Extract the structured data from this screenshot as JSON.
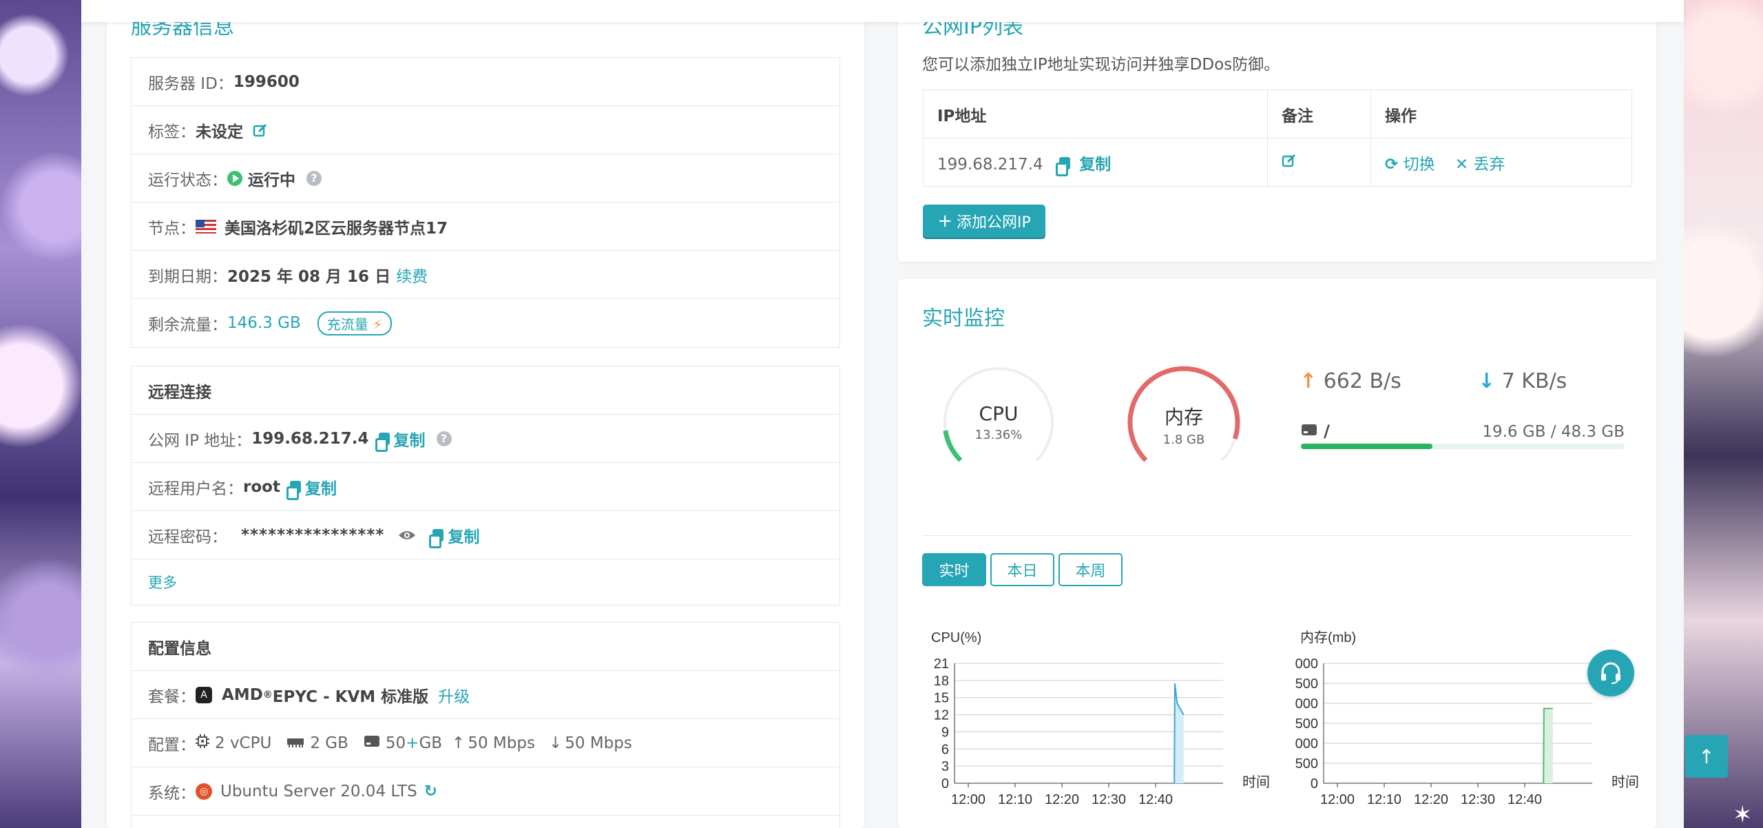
{
  "server_info": {
    "title": "服务器信息",
    "id_label": "服务器 ID：",
    "id_value": "199600",
    "tag_label": "标签：",
    "tag_value": "未设定",
    "status_label": "运行状态：",
    "status_value": "运行中",
    "node_label": "节点：",
    "node_value": "美国洛杉矶2区云服务器节点17",
    "expiry_label": "到期日期：",
    "expiry_value": "2025 年 08 月 16 日",
    "renew_link": "续费",
    "traffic_label": "剩余流量：",
    "traffic_value": "146.3 GB",
    "recharge_button": "充流量"
  },
  "remote": {
    "header": "远程连接",
    "ip_label": "公网 IP 地址：",
    "ip_value": "199.68.217.4",
    "copy_label": "复制",
    "user_label": "远程用户名：",
    "user_value": "root",
    "password_label": "远程密码：",
    "password_value": "****************",
    "more_link": "更多"
  },
  "config": {
    "header": "配置信息",
    "package_label": "套餐：",
    "package_value": "AMD",
    "package_reg": "®",
    "package_value2": " EPYC - KVM 标准版",
    "upgrade_link": "升级",
    "spec_label": "配置：",
    "cpu": "2 vCPU",
    "ram": "2 GB",
    "disk": "50",
    "disk_plus": "+",
    "disk_unit": " GB",
    "up": "50 Mbps",
    "down": "50 Mbps",
    "os_label": "系统：",
    "os_value": "Ubuntu Server 20.04 LTS"
  },
  "ip_list": {
    "title": "公网IP列表",
    "desc": "您可以添加独立IP地址实现访问并独享DDos防御。",
    "headers": [
      "IP地址",
      "备注",
      "操作"
    ],
    "rows": [
      {
        "ip": "199.68.217.4"
      }
    ],
    "copy_label": "复制",
    "switch_label": "切换",
    "discard_label": "丢弃",
    "add_button": "添加公网IP"
  },
  "monitor": {
    "title": "实时监控",
    "cpu_name": "CPU",
    "cpu_value": "13.36%",
    "cpu_fraction": 0.1336,
    "mem_name": "内存",
    "mem_value": "1.8 GB",
    "mem_fraction": 0.9,
    "upload": "662 B/s",
    "download": "7 KB/s",
    "disk_path": "/",
    "disk_usage": "19.6 GB / 48.3 GB",
    "disk_fraction": 0.406,
    "tabs": [
      "实时",
      "本日",
      "本周"
    ],
    "colors": {
      "accent": "#26a5b5",
      "cpu": "#3cc174",
      "mem": "#e26a6a",
      "upload": "#f0954a",
      "download": "#2ba8d8"
    }
  },
  "chart_data": [
    {
      "type": "area",
      "title": "CPU(%)",
      "xlabel": "时间",
      "x_ticks": [
        "12:00",
        "12:10",
        "12:20",
        "12:30",
        "12:40"
      ],
      "y_ticks": [
        "0",
        "3",
        "6",
        "9",
        "12",
        "15",
        "18",
        "21"
      ],
      "ylim": [
        0,
        21
      ],
      "xlim": [
        0,
        50
      ],
      "series": [
        {
          "x": [
            44,
            44.1,
            44.6,
            46
          ],
          "y": [
            0,
            17.5,
            14,
            12
          ]
        }
      ]
    },
    {
      "type": "area",
      "title": "内存(mb)",
      "xlabel": "时间",
      "x_ticks": [
        "12:00",
        "12:10",
        "12:20",
        "12:30",
        "12:40"
      ],
      "y_ticks": [
        "0",
        "500",
        "000",
        "500",
        "000",
        "500",
        "000"
      ],
      "ylim": [
        0,
        3000
      ],
      "xlim": [
        0,
        50
      ],
      "series": [
        {
          "x": [
            44,
            44.1,
            46
          ],
          "y": [
            0,
            1870,
            1870
          ]
        }
      ]
    }
  ]
}
